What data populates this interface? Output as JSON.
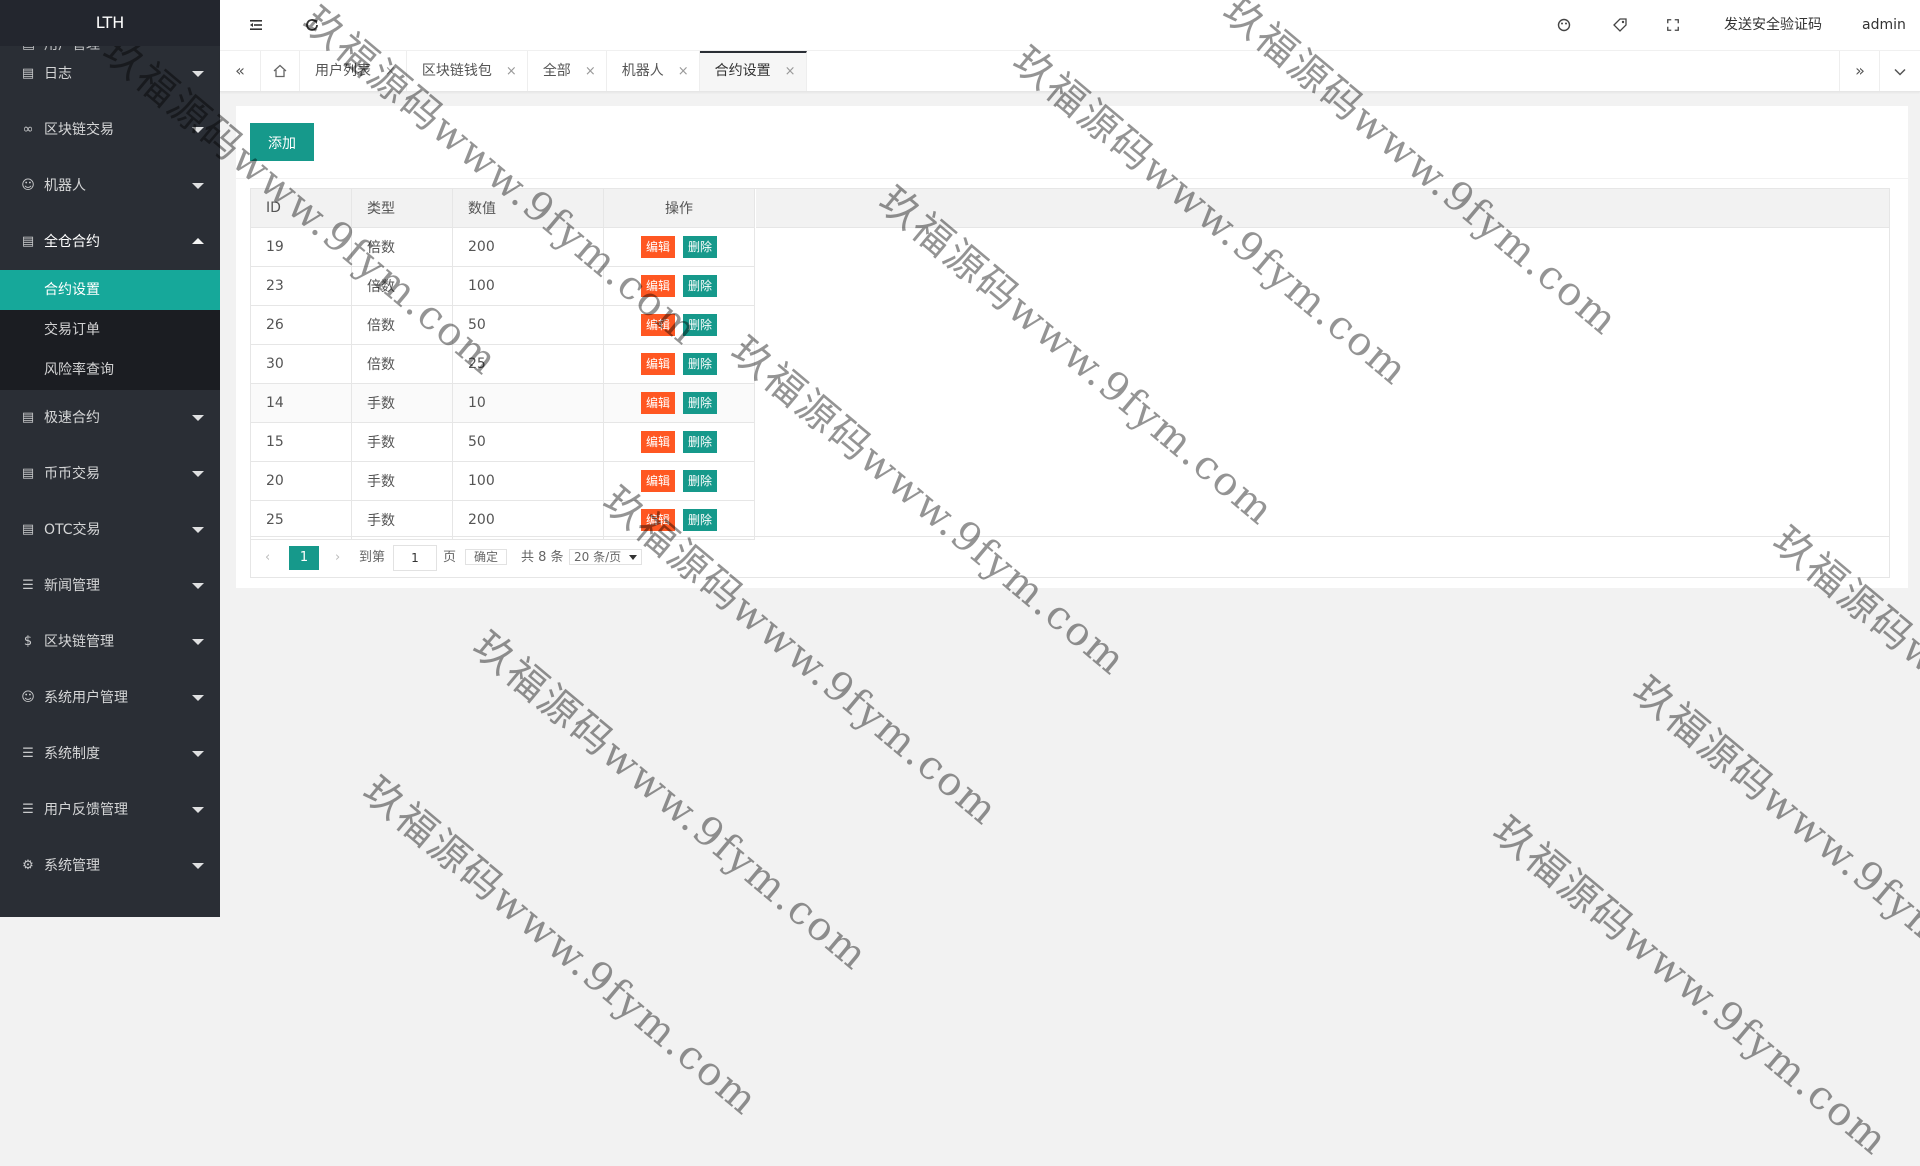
{
  "sidebar": {
    "logo": "LTH",
    "partial_item": "用户管理",
    "items": [
      {
        "label": "日志",
        "icon": "doc-icon"
      },
      {
        "label": "区块链交易",
        "icon": "link-icon"
      },
      {
        "label": "机器人",
        "icon": "user-icon"
      },
      {
        "label": "全仓合约",
        "icon": "doc-icon",
        "expanded": true,
        "children": [
          {
            "label": "合约设置",
            "active": true
          },
          {
            "label": "交易订单"
          },
          {
            "label": "风险率查询"
          }
        ]
      },
      {
        "label": "极速合约",
        "icon": "doc-icon"
      },
      {
        "label": "币币交易",
        "icon": "doc-icon"
      },
      {
        "label": "OTC交易",
        "icon": "doc-icon"
      },
      {
        "label": "新闻管理",
        "icon": "list-icon"
      },
      {
        "label": "区块链管理",
        "icon": "dollar-icon"
      },
      {
        "label": "系统用户管理",
        "icon": "user-icon"
      },
      {
        "label": "系统制度",
        "icon": "list-icon"
      },
      {
        "label": "用户反馈管理",
        "icon": "list-icon"
      },
      {
        "label": "系统管理",
        "icon": "gear-icon"
      }
    ]
  },
  "header": {
    "send_code": "发送安全验证码",
    "user": "admin"
  },
  "tabs": [
    {
      "label": "用户列表"
    },
    {
      "label": "区块链钱包"
    },
    {
      "label": "全部"
    },
    {
      "label": "机器人"
    },
    {
      "label": "合约设置",
      "active": true
    }
  ],
  "toolbar": {
    "add_label": "添加"
  },
  "table": {
    "columns": [
      "ID",
      "类型",
      "数值",
      "操作"
    ],
    "edit_label": "编辑",
    "delete_label": "删除",
    "rows": [
      [
        "19",
        "倍数",
        "200"
      ],
      [
        "23",
        "倍数",
        "100"
      ],
      [
        "26",
        "倍数",
        "50"
      ],
      [
        "30",
        "倍数",
        "25"
      ],
      [
        "14",
        "手数",
        "10"
      ],
      [
        "15",
        "手数",
        "50"
      ],
      [
        "20",
        "手数",
        "100"
      ],
      [
        "25",
        "手数",
        "200"
      ]
    ]
  },
  "pager": {
    "current": "1",
    "goto_label": "到第",
    "page_input": "1",
    "page_unit": "页",
    "confirm": "确定",
    "total": "共 8 条",
    "per_page": "20 条/页"
  },
  "watermark": "玖福源码www.9fym.com",
  "colors": {
    "sidebar_bg": "#2a2e35",
    "accent": "#16998b",
    "active_menu": "#16a89a",
    "edit_btn": "#ff5722"
  }
}
